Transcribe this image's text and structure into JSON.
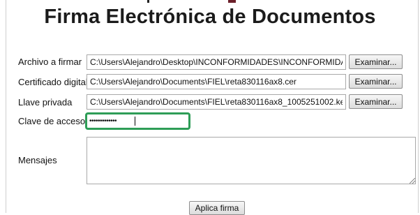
{
  "title": "Firma Electrónica de Documentos",
  "form": {
    "archivo": {
      "label": "Archivo a firmar",
      "value": "C:\\Users\\Alejandro\\Desktop\\INCONFORMIDADES\\INCONFORMIDA",
      "button": "Examinar..."
    },
    "certificado": {
      "label": "Certificado digital",
      "value": "C:\\Users\\Alejandro\\Documents\\FIEL\\reta830116ax8.cer",
      "button": "Examinar..."
    },
    "llave": {
      "label": "Llave privada",
      "value": "C:\\Users\\Alejandro\\Documents\\FIEL\\reta830116ax8_1005251002.ke",
      "button": "Examinar..."
    },
    "clave": {
      "label": "Clave de acceso",
      "value": "•••••••••••••"
    },
    "mensajes": {
      "label": "Mensajes",
      "value": ""
    }
  },
  "actions": {
    "sign_label": "Aplica firma"
  },
  "colors": {
    "focus_border": "#2e9d57",
    "top_accent": "#6b1f2a"
  }
}
